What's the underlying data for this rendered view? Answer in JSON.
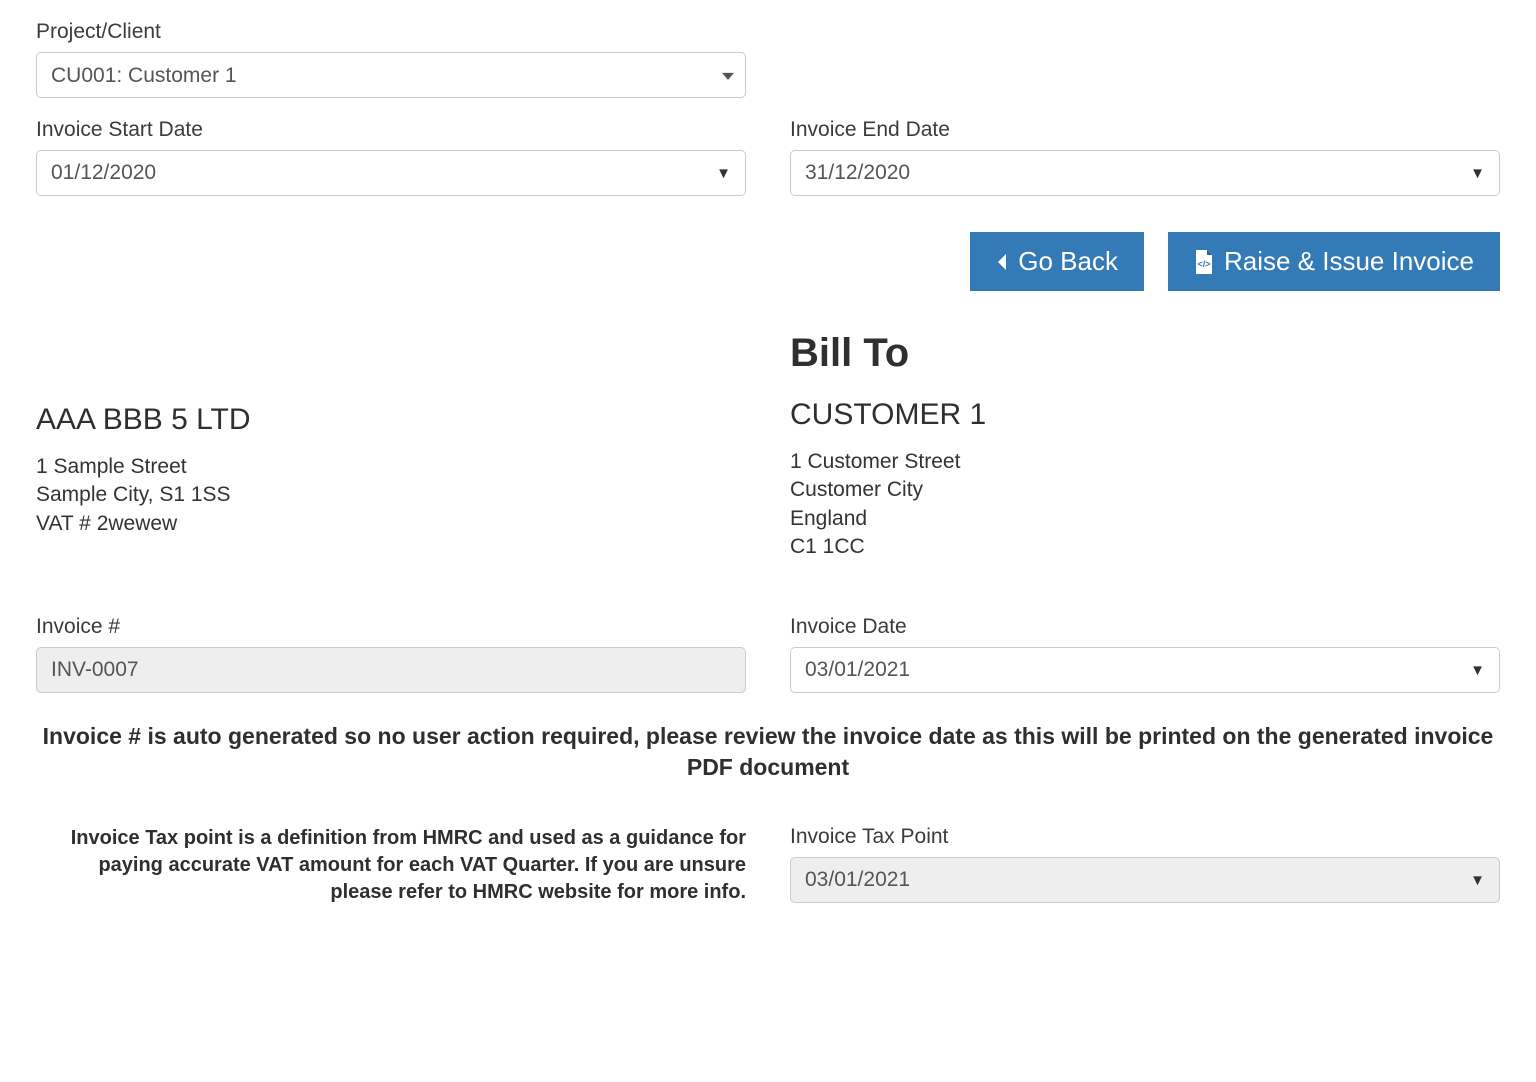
{
  "projectClient": {
    "label": "Project/Client",
    "selected": "CU001: Customer 1"
  },
  "invoiceStart": {
    "label": "Invoice Start Date",
    "value": "01/12/2020"
  },
  "invoiceEnd": {
    "label": "Invoice End Date",
    "value": "31/12/2020"
  },
  "actions": {
    "goBack": "Go Back",
    "raiseIssue": "Raise & Issue Invoice"
  },
  "from": {
    "name": "AAA BBB 5 LTD",
    "line1": "1 Sample Street",
    "line2": "Sample City, S1 1SS",
    "vat": "VAT # 2wewew"
  },
  "billTo": {
    "heading": "Bill To",
    "name": "CUSTOMER 1",
    "line1": "1 Customer Street",
    "line2": "Customer City",
    "line3": "England",
    "line4": "C1 1CC"
  },
  "invoiceNumber": {
    "label": "Invoice #",
    "value": "INV-0007"
  },
  "invoiceDate": {
    "label": "Invoice Date",
    "value": "03/01/2021"
  },
  "note": "Invoice # is auto generated so no user action required, please review the invoice date as this will be printed on the generated invoice PDF document",
  "taxPointNote": "Invoice Tax point is a definition from HMRC and used as a guidance for paying accurate VAT amount for each VAT Quarter. If you are unsure please refer to HMRC website for more info.",
  "taxPoint": {
    "label": "Invoice Tax Point",
    "value": "03/01/2021"
  }
}
